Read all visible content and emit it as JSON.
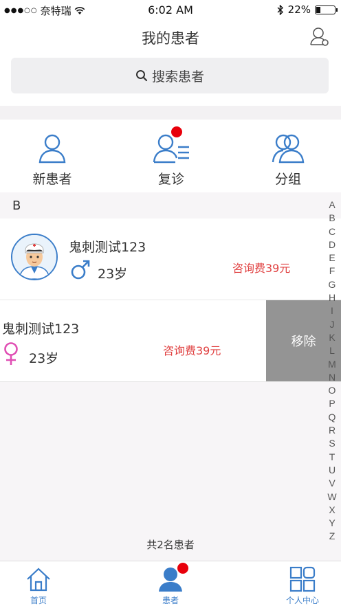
{
  "status_bar": {
    "carrier": "奈特瑞",
    "time": "6:02 AM",
    "battery": "22%"
  },
  "nav": {
    "title": "我的患者"
  },
  "search": {
    "placeholder": "搜索患者"
  },
  "actions": [
    {
      "label": "新患者",
      "icon": "person-outline-icon"
    },
    {
      "label": "复诊",
      "icon": "person-list-icon",
      "badge": true
    },
    {
      "label": "分组",
      "icon": "group-icon"
    }
  ],
  "section": {
    "letter": "B"
  },
  "patients": [
    {
      "name": "鬼刺测试123",
      "age": "23岁",
      "fee": "咨询费39元",
      "gender": "male-icon"
    },
    {
      "name": "鬼刺测试123",
      "age": "23岁",
      "fee": "咨询费39元",
      "gender": "female-icon",
      "action": "移除"
    }
  ],
  "index_letters": [
    "A",
    "B",
    "C",
    "D",
    "E",
    "F",
    "G",
    "H",
    "I",
    "J",
    "K",
    "L",
    "M",
    "N",
    "O",
    "P",
    "Q",
    "R",
    "S",
    "T",
    "U",
    "V",
    "W",
    "X",
    "Y",
    "Z"
  ],
  "footer": {
    "count": "共2名患者"
  },
  "tabbar": [
    {
      "label": "首页",
      "icon": "home-icon"
    },
    {
      "label": "患者",
      "icon": "patients-icon",
      "badge": true
    },
    {
      "label": "个人中心",
      "icon": "grid-icon"
    }
  ],
  "colors": {
    "accent": "#3a7dc9",
    "fee": "#e04040",
    "badge": "#e8000b",
    "remove_bg": "#949494"
  }
}
